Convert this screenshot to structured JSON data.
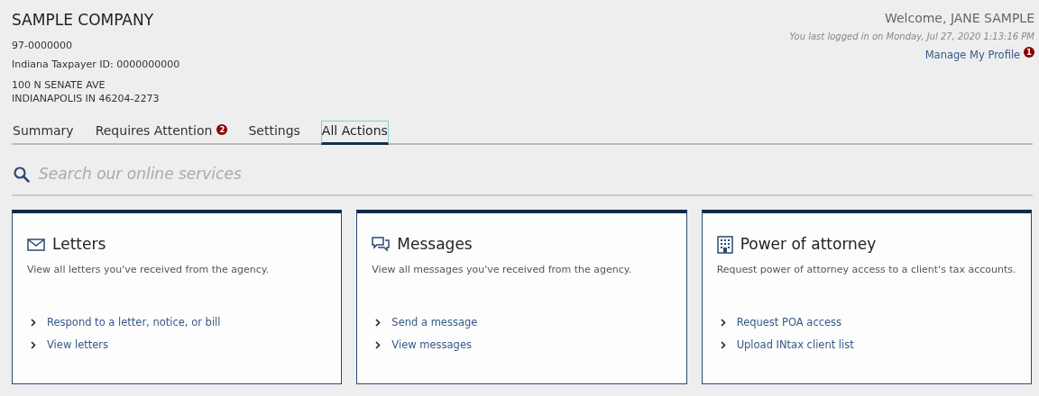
{
  "company": {
    "name": "SAMPLE COMPANY",
    "lines": [
      "97-0000000",
      "Indiana Taxpayer ID: 0000000000"
    ],
    "address": [
      "100 N SENATE AVE",
      "INDIANAPOLIS IN 46204-2273"
    ]
  },
  "user": {
    "welcome": "Welcome, JANE SAMPLE",
    "last_login": "You last logged in on Monday, Jul 27, 2020 1:13:16 PM",
    "profile_link": "Manage My Profile",
    "profile_badge": "1"
  },
  "tabs": [
    {
      "label": "Summary",
      "selected": false
    },
    {
      "label": "Requires Attention",
      "selected": false,
      "badge": "2"
    },
    {
      "label": "Settings",
      "selected": false
    },
    {
      "label": "All Actions",
      "selected": true
    }
  ],
  "search": {
    "placeholder": "Search our online services"
  },
  "cards": [
    {
      "kind": "envelope",
      "title": "Letters",
      "description": "View all letters you've received from the agency.",
      "links": [
        "Respond to a letter, notice, or bill",
        "View letters"
      ]
    },
    {
      "kind": "chat",
      "title": "Messages",
      "description": "View all messages you've received from the agency.",
      "links": [
        "Send a message",
        "View messages"
      ]
    },
    {
      "kind": "building",
      "title": "Power of attorney",
      "description": "Request power of attorney access to a client's tax accounts.",
      "links": [
        "Request POA access",
        "Upload INtax client list"
      ]
    }
  ]
}
